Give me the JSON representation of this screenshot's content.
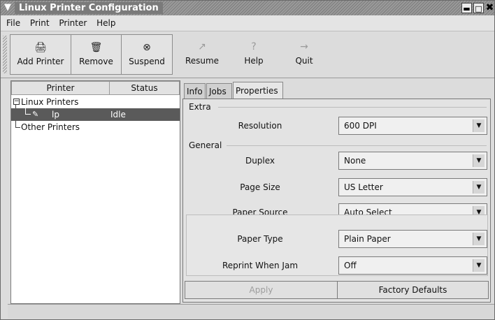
{
  "window": {
    "title": "Linux Printer Configuration"
  },
  "menubar": {
    "items": [
      "File",
      "Print",
      "Printer",
      "Help"
    ]
  },
  "toolbar": {
    "buttons": [
      {
        "label": "Add Printer",
        "icon": "printer-add-icon",
        "glyph": "🖨"
      },
      {
        "label": "Remove",
        "icon": "trash-icon",
        "glyph": "🗑"
      },
      {
        "label": "Suspend",
        "icon": "stop-circle-icon",
        "glyph": "⊗"
      },
      {
        "label": "Resume",
        "icon": "resume-arrow-icon",
        "glyph": "↗"
      },
      {
        "label": "Help",
        "icon": "help-icon",
        "glyph": "?"
      },
      {
        "label": "Quit",
        "icon": "quit-icon",
        "glyph": "→"
      }
    ]
  },
  "printer_list": {
    "columns": [
      "Printer",
      "Status"
    ],
    "groups": [
      {
        "label": "Linux Printers",
        "expander": "−"
      },
      {
        "label": "Other Printers"
      }
    ],
    "printers": [
      {
        "name": "lp",
        "status": "Idle"
      }
    ]
  },
  "tabs": [
    "Info",
    "Jobs",
    "Properties"
  ],
  "active_tab": "Properties",
  "properties": {
    "extra_label": "Extra",
    "general_label": "General",
    "resolution": {
      "label": "Resolution",
      "value": "600 DPI"
    },
    "duplex": {
      "label": "Duplex",
      "value": "None"
    },
    "page_size": {
      "label": "Page Size",
      "value": "US Letter"
    },
    "paper_source": {
      "label": "Paper Source",
      "value": "Auto Select"
    },
    "paper_type": {
      "label": "Paper Type",
      "value": "Plain Paper"
    },
    "reprint_when_jam": {
      "label": "Reprint When Jam",
      "value": "Off"
    }
  },
  "buttons": {
    "apply": "Apply",
    "factory_defaults": "Factory Defaults"
  }
}
